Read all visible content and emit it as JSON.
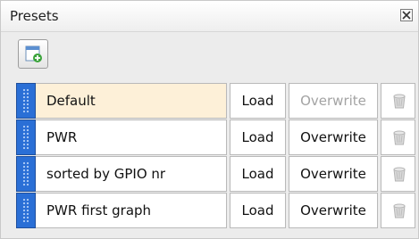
{
  "panel": {
    "title": "Presets",
    "close_icon": "close-x-icon",
    "add_icon": "new-preset-icon"
  },
  "presets": [
    {
      "name": "Default",
      "load_label": "Load",
      "overwrite_label": "Overwrite",
      "overwrite_enabled": false,
      "selected": true
    },
    {
      "name": "PWR",
      "load_label": "Load",
      "overwrite_label": "Overwrite",
      "overwrite_enabled": true,
      "selected": false
    },
    {
      "name": "sorted by GPIO nr",
      "load_label": "Load",
      "overwrite_label": "Overwrite",
      "overwrite_enabled": true,
      "selected": false
    },
    {
      "name": "PWR first graph",
      "load_label": "Load",
      "overwrite_label": "Overwrite",
      "overwrite_enabled": true,
      "selected": false
    }
  ],
  "colors": {
    "handle": "#2a6fd6",
    "selected_row": "#fdf0d8",
    "disabled_text": "#a3a3a3",
    "add_plus": "#3aa33a"
  }
}
